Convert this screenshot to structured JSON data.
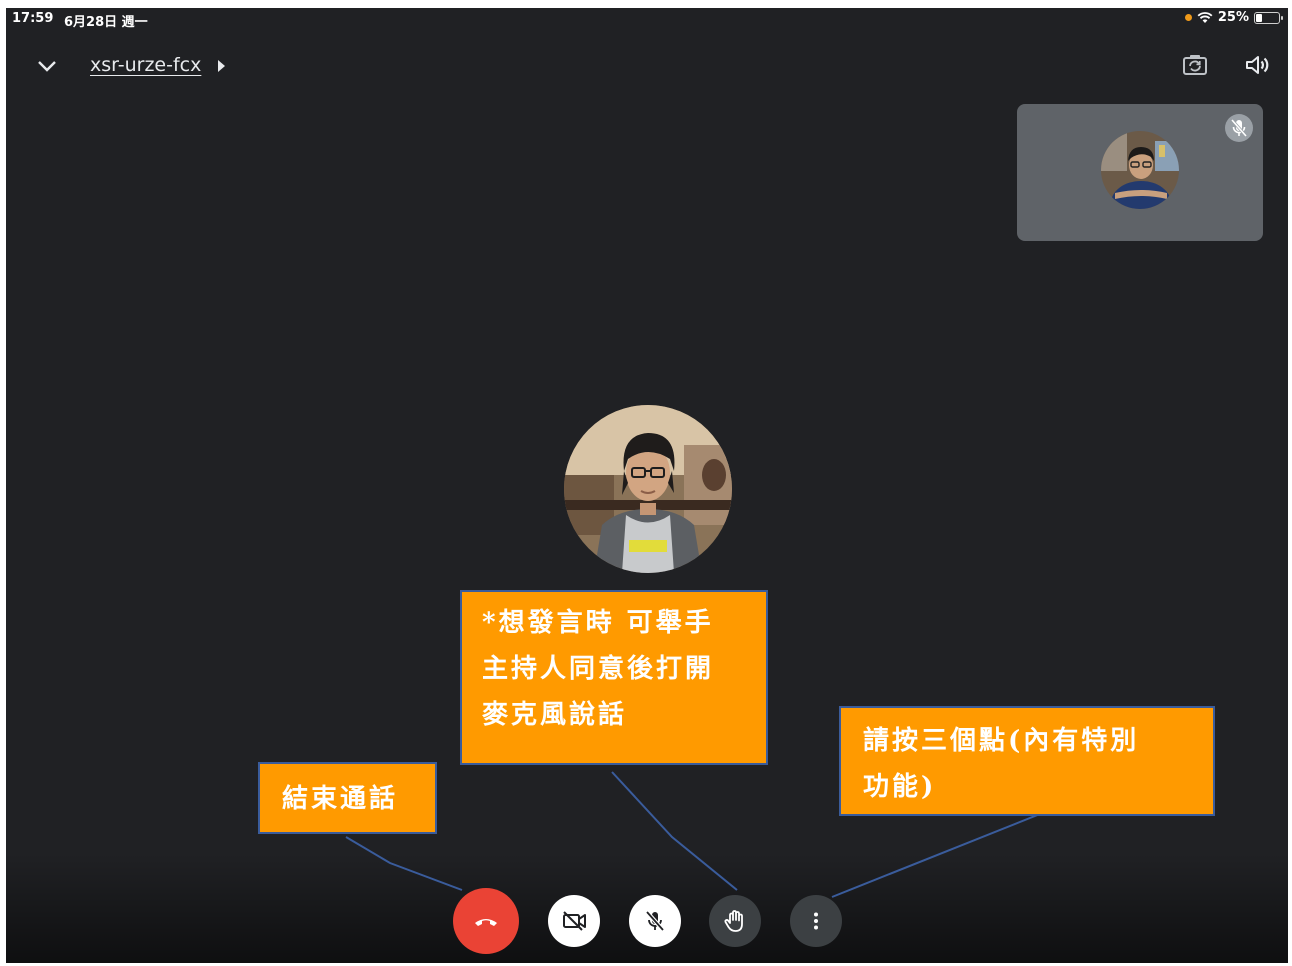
{
  "status_bar": {
    "time": "17:59",
    "date": "6月28日 週一",
    "battery": "25%",
    "battery_level": 0.25
  },
  "header": {
    "meeting_code": "xsr-urze-fcx"
  },
  "callouts": {
    "raise_hand_lines": [
      "*想發言時 可舉手",
      "主持人同意後打開",
      "麥克風說話"
    ],
    "end_call": "結束通話",
    "more_lines": [
      "請按三個點(內有特別",
      "功能)"
    ]
  },
  "colors": {
    "background": "#202124",
    "end_call": "#ea4335",
    "callout_fill": "#ff9a00",
    "callout_border": "#3a5c9c",
    "self_tile": "#5f6368"
  },
  "icons": {
    "collapse": "chevron-down-icon",
    "camera_switch": "camera-switch-icon",
    "speaker": "speaker-icon",
    "end_call": "phone-hangup-icon",
    "camera_off": "camera-off-icon",
    "mic_off": "mic-off-icon",
    "raise_hand": "hand-icon",
    "more": "more-vert-icon"
  }
}
